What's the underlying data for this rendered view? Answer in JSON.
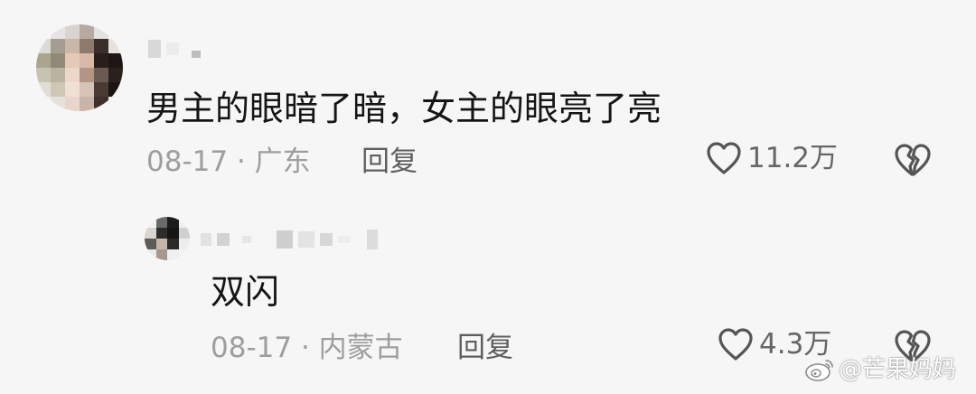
{
  "comments": [
    {
      "text": "男主的眼暗了暗，女主的眼亮了亮",
      "date": "08-17",
      "separator": "·",
      "location": "广东",
      "reply_label": "回复",
      "likes": "11.2万",
      "like_icon": "heart-outline-icon",
      "dislike_icon": "broken-heart-icon"
    },
    {
      "text": "双闪",
      "date": "08-17",
      "separator": "·",
      "location": "内蒙古",
      "reply_label": "回复",
      "likes": "4.3万",
      "like_icon": "heart-outline-icon",
      "dislike_icon": "broken-heart-icon"
    }
  ],
  "watermark": {
    "text": "@芒果妈妈",
    "icon": "weibo-logo-icon"
  },
  "colors": {
    "background": "#f6f6f6",
    "text": "#151515",
    "meta": "#9e9e9e",
    "reply": "#5e5e5e",
    "icon": "#555555"
  }
}
